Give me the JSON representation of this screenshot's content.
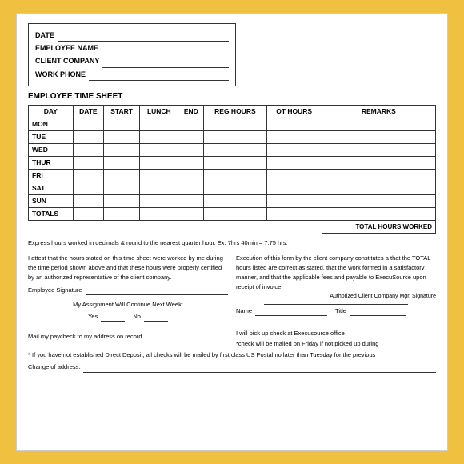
{
  "header": {
    "date_label": "DATE",
    "employee_name_label": "EMPLOYEE NAME",
    "client_company_label": "CLIENT COMPANY",
    "work_phone_label": "WORK PHONE"
  },
  "section_title": "EMPLOYEE TIME SHEET",
  "table": {
    "columns": [
      "DAY",
      "DATE",
      "START",
      "LUNCH",
      "END",
      "REG HOURS",
      "OT HOURS",
      "REMARKS"
    ],
    "rows": [
      {
        "day": "MON"
      },
      {
        "day": "TUE"
      },
      {
        "day": "WED"
      },
      {
        "day": "THUR"
      },
      {
        "day": "FRI"
      },
      {
        "day": "SAT"
      },
      {
        "day": "SUN"
      },
      {
        "day": "TOTALS"
      }
    ],
    "total_label": "TOTAL HOURS WORKED"
  },
  "note": "Express hours worked in decimals & round to the nearest quarter hour.  Ex.  7hrs 40min = 7.75 hrs.",
  "attestation_left": "I attest that the hours stated on this time sheet were worked by me during the time period shown above and that these hours were properly certified by an authorized representative of the client company.",
  "employee_sig_label": "Employee Signature",
  "attestation_right": "Execution of this form by the client company constitutes a that the TOTAL hours listed are correct as stated, that the work formed in a satisfactory manner, and that the applicable fees and payable to ExecuSource upon receipt of invoice",
  "authorized_sig_label": "Authorized Client Company Mgr. Signature",
  "assignment_title": "My Assignment Will Continue Next Week:",
  "yes_label": "Yes",
  "no_label": "No",
  "name_label": "Name",
  "title_label": "Title",
  "mail_label": "Mail my paycheck to my address on record",
  "pickup_label": "I will pick up check at Execusource office",
  "check_note": "*check will be mailed on Friday if not picked up during",
  "direct_deposit_note": "* If you have not established Direct Deposit, all checks will be mailed by first class US Postal no later than Tuesday for the previous",
  "change_label": "Change of address:"
}
